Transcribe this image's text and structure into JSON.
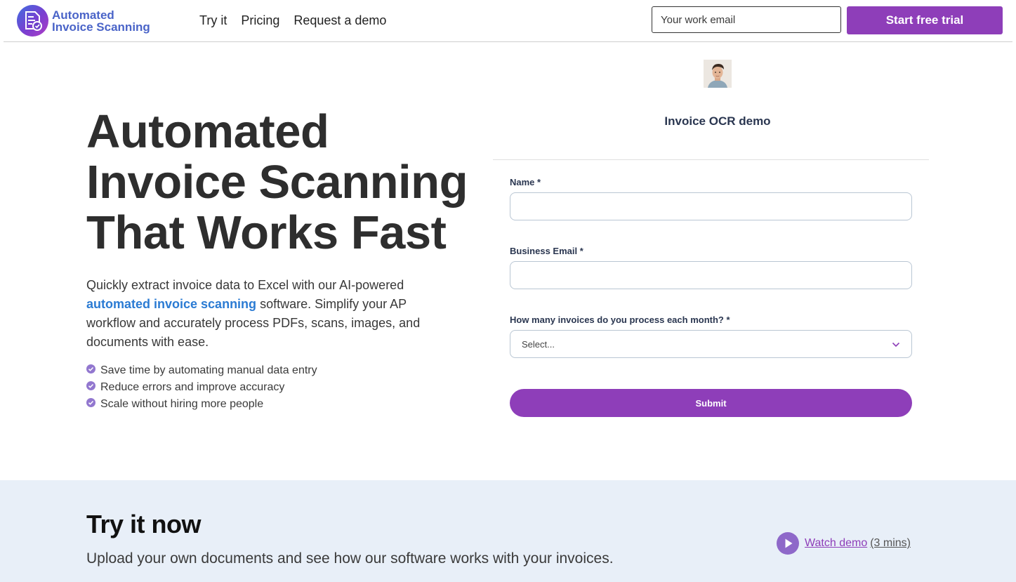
{
  "header": {
    "logo_line1": "Automated",
    "logo_line2": "Invoice Scanning",
    "nav": [
      "Try it",
      "Pricing",
      "Request a demo"
    ],
    "email_placeholder": "Your work email",
    "trial_label": "Start free trial"
  },
  "hero": {
    "title": "Automated Invoice Scanning That Works Fast",
    "desc_before": "Quickly extract invoice data to Excel with our AI-powered ",
    "desc_link": "automated invoice scanning",
    "desc_after": " software. Simplify your AP workflow and accurately process PDFs, scans, images, and documents with ease.",
    "bullets": [
      "Save time by automating manual data entry",
      "Reduce errors and improve accuracy",
      "Scale without hiring more people"
    ]
  },
  "form": {
    "title": "Invoice OCR demo",
    "name_label": "Name *",
    "email_label": "Business Email *",
    "invoices_label": "How many invoices do you process each month? *",
    "select_value": "Select...",
    "submit_label": "Submit"
  },
  "try_section": {
    "title": "Try it now",
    "desc": "Upload your own documents and see how our software works with your invoices.",
    "watch_label": "Watch demo ",
    "watch_duration": "(3 mins)"
  },
  "colors": {
    "accent": "#8e3eb9",
    "link": "#2b7bd3",
    "band": "#e8eff8"
  }
}
